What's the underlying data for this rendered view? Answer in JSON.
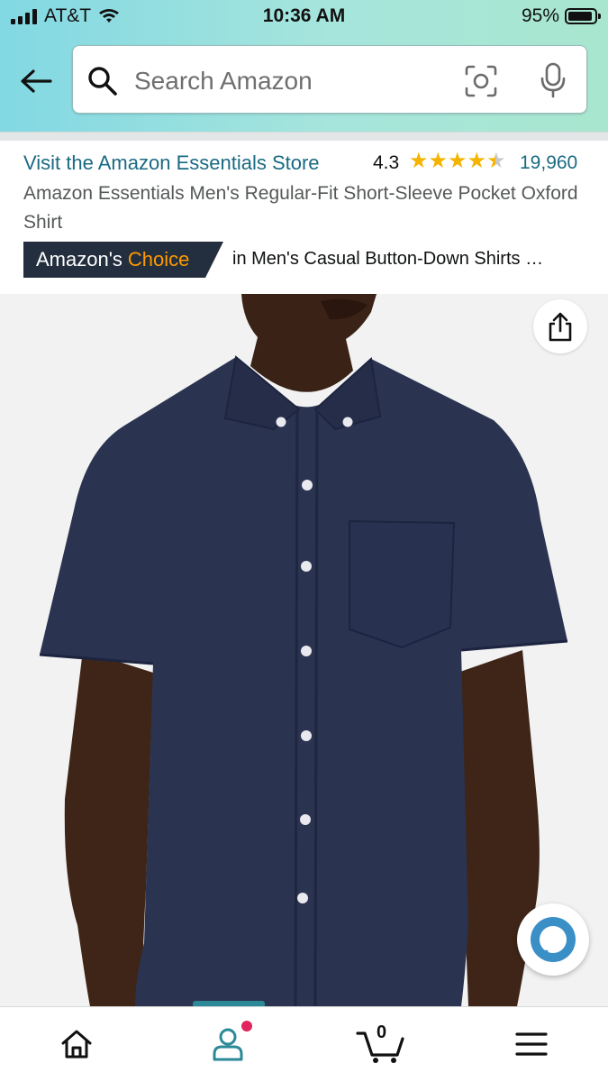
{
  "status_bar": {
    "carrier": "AT&T",
    "time": "10:36 AM",
    "battery": "95%"
  },
  "search": {
    "placeholder": "Search Amazon",
    "icons": [
      "search-icon",
      "camera-icon",
      "mic-icon"
    ]
  },
  "product": {
    "store_link": "Visit the Amazon Essentials Store",
    "rating": "4.3",
    "rating_value": 4.3,
    "review_count": "19,960",
    "title": "Amazon Essentials Men's Regular-Fit Short-Sleeve Pocket Oxford Shirt",
    "badge": {
      "prefix": "Amazon's",
      "highlight": "Choice",
      "category": "in Men's Casual Button-Down Shirts …"
    }
  },
  "bottom_nav": {
    "items": [
      "home-icon",
      "account-icon",
      "cart-icon",
      "menu-icon"
    ],
    "cart_count": "0"
  },
  "colors": {
    "link": "#1a6a82",
    "star": "#f4b400",
    "badge_bg": "#232f3e",
    "badge_accent": "#ff9900",
    "shirt": "#2a3350",
    "active_tab": "#2c8a98"
  }
}
